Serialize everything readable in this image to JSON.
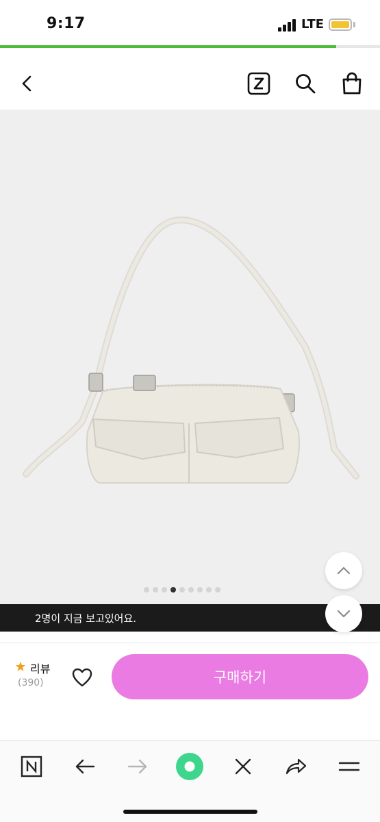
{
  "status_bar": {
    "time": "9:17",
    "network": "LTE",
    "battery_color": "#f4c430"
  },
  "page_load_progress": 0.885,
  "header": {
    "back_icon": "chevron-left-icon",
    "z_icon": "zigzag-logo-icon",
    "search_icon": "search-icon",
    "cart_icon": "shopping-bag-icon"
  },
  "product": {
    "image_description_icon": "product-photo",
    "carousel": {
      "total": 9,
      "active_index": 3
    }
  },
  "scroll_buttons": {
    "up_icon": "chevron-up-icon",
    "down_icon": "chevron-down-icon"
  },
  "viewer_banner": {
    "text": "2명이 지금 보고있어요."
  },
  "purchase_bar": {
    "review_label": "리뷰",
    "review_count": "(390)",
    "star_color": "#f0a020",
    "buy_label": "구매하기",
    "buy_color": "#ea7be2"
  },
  "browser_toolbar": {
    "items": [
      "naver-n-icon",
      "back-arrow-icon",
      "forward-arrow-icon",
      "green-circle-icon",
      "close-icon",
      "share-icon",
      "menu-icon"
    ],
    "accent": "#3dd68c"
  }
}
